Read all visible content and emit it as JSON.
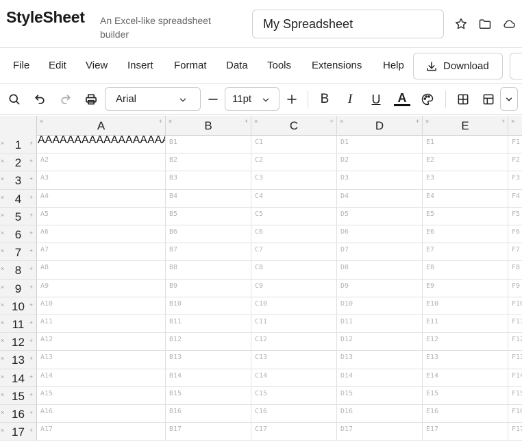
{
  "app": {
    "name": "StyleSheet",
    "tagline": "An Excel-like spreadsheet builder"
  },
  "document": {
    "title": "My Spreadsheet"
  },
  "header_icons": [
    "star-icon",
    "folder-icon",
    "cloud-icon"
  ],
  "menu": {
    "items": [
      "File",
      "Edit",
      "View",
      "Insert",
      "Format",
      "Data",
      "Tools",
      "Extensions",
      "Help"
    ],
    "download_label": "Download"
  },
  "toolbar": {
    "font_family": "Arial",
    "font_size": "11pt",
    "decrease_label": "−",
    "increase_label": "+",
    "bold_label": "B",
    "italic_label": "I",
    "underline_label": "U",
    "text_color_label": "A"
  },
  "grid": {
    "columns": [
      "A",
      "B",
      "C",
      "D",
      "E",
      "F"
    ],
    "rows": [
      "1",
      "2",
      "3",
      "4",
      "5",
      "6",
      "7",
      "8",
      "9",
      "10",
      "11",
      "12",
      "13",
      "14",
      "15",
      "16",
      "17"
    ],
    "cell_values": {
      "A1": "AAAAAAAAAAAAAAAAAAAAAAAAAAAAAAAA"
    },
    "marker_remove": "×",
    "marker_add": "+"
  },
  "colors": {
    "header_bg": "#f3f3f3",
    "grid_line": "#e0e0e0",
    "placeholder_text": "#b4b4b4"
  }
}
